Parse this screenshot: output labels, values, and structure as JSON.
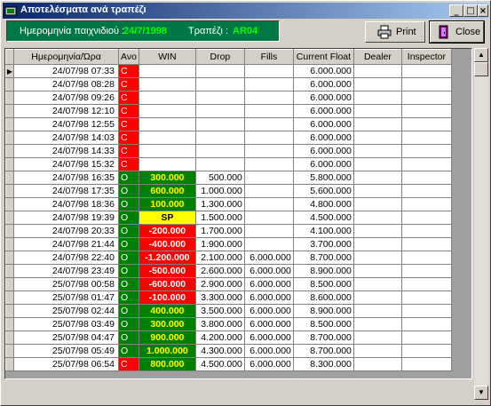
{
  "window": {
    "title": "Αποτελέσματα ανά τραπέζι",
    "min": "_",
    "max": "□",
    "close": "×"
  },
  "info": {
    "date_label": "Ημερομηνία παιχνιδιού :",
    "date_value": "24/7/1998",
    "table_label": "Τραπέζι :",
    "table_value": "AR04"
  },
  "buttons": {
    "print": "Print",
    "close": "Close"
  },
  "colors": {
    "panel_green": "#007846",
    "status_red": "#ff0000",
    "status_green": "#008000",
    "win_yellow_text": "#ffff00",
    "sp_yellow": "#ffff00"
  },
  "grid": {
    "columns": [
      "Ημερομηνία/Ώρα",
      "Ανο",
      "WIN",
      "Drop",
      "Fills",
      "Current Float",
      "Dealer",
      "Inspector"
    ],
    "rows": [
      {
        "dt": "24/07/98 07:33",
        "st": "C",
        "win": "",
        "drop": "",
        "fills": "",
        "float": "6.000.000"
      },
      {
        "dt": "24/07/98 08:28",
        "st": "C",
        "win": "",
        "drop": "",
        "fills": "",
        "float": "6.000.000"
      },
      {
        "dt": "24/07/98 09:26",
        "st": "C",
        "win": "",
        "drop": "",
        "fills": "",
        "float": "6.000.000"
      },
      {
        "dt": "24/07/98 12:10",
        "st": "C",
        "win": "",
        "drop": "",
        "fills": "",
        "float": "6.000.000"
      },
      {
        "dt": "24/07/98 12:55",
        "st": "C",
        "win": "",
        "drop": "",
        "fills": "",
        "float": "6.000.000"
      },
      {
        "dt": "24/07/98 14:03",
        "st": "C",
        "win": "",
        "drop": "",
        "fills": "",
        "float": "6.000.000"
      },
      {
        "dt": "24/07/98 14:33",
        "st": "C",
        "win": "",
        "drop": "",
        "fills": "",
        "float": "6.000.000"
      },
      {
        "dt": "24/07/98 15:32",
        "st": "C",
        "win": "",
        "drop": "",
        "fills": "",
        "float": "6.000.000"
      },
      {
        "dt": "24/07/98 16:35",
        "st": "O",
        "win": "300.000",
        "drop": "500.000",
        "fills": "",
        "float": "5.800.000"
      },
      {
        "dt": "24/07/98 17:35",
        "st": "O",
        "win": "600.000",
        "drop": "1.000.000",
        "fills": "",
        "float": "5.600.000"
      },
      {
        "dt": "24/07/98 18:36",
        "st": "O",
        "win": "100.000",
        "drop": "1.300.000",
        "fills": "",
        "float": "4.800.000"
      },
      {
        "dt": "24/07/98 19:39",
        "st": "O",
        "win": "SP",
        "drop": "1.500.000",
        "fills": "",
        "float": "4.500.000"
      },
      {
        "dt": "24/07/98 20:33",
        "st": "O",
        "win": "-200.000",
        "drop": "1.700.000",
        "fills": "",
        "float": "4.100.000"
      },
      {
        "dt": "24/07/98 21:44",
        "st": "O",
        "win": "-400.000",
        "drop": "1.900.000",
        "fills": "",
        "float": "3.700.000"
      },
      {
        "dt": "24/07/98 22:40",
        "st": "O",
        "win": "-1.200.000",
        "drop": "2.100.000",
        "fills": "6.000.000",
        "float": "8.700.000"
      },
      {
        "dt": "24/07/98 23:49",
        "st": "O",
        "win": "-500.000",
        "drop": "2.600.000",
        "fills": "6.000.000",
        "float": "8.900.000"
      },
      {
        "dt": "25/07/98 00:58",
        "st": "O",
        "win": "-600.000",
        "drop": "2.900.000",
        "fills": "6.000.000",
        "float": "8.500.000"
      },
      {
        "dt": "25/07/98 01:47",
        "st": "O",
        "win": "-100.000",
        "drop": "3.300.000",
        "fills": "6.000.000",
        "float": "8.600.000"
      },
      {
        "dt": "25/07/98 02:44",
        "st": "O",
        "win": "400.000",
        "drop": "3.500.000",
        "fills": "6.000.000",
        "float": "8.900.000"
      },
      {
        "dt": "25/07/98 03:49",
        "st": "O",
        "win": "300.000",
        "drop": "3.800.000",
        "fills": "6.000.000",
        "float": "8.500.000"
      },
      {
        "dt": "25/07/98 04:47",
        "st": "O",
        "win": "900.000",
        "drop": "4.200.000",
        "fills": "6.000.000",
        "float": "8.700.000"
      },
      {
        "dt": "25/07/98 05:49",
        "st": "O",
        "win": "1.000.000",
        "drop": "4.300.000",
        "fills": "6.000.000",
        "float": "8.700.000"
      },
      {
        "dt": "25/07/98 06:54",
        "st": "C",
        "win": "800.000",
        "drop": "4.500.000",
        "fills": "6.000.000",
        "float": "8.300.000"
      }
    ]
  }
}
